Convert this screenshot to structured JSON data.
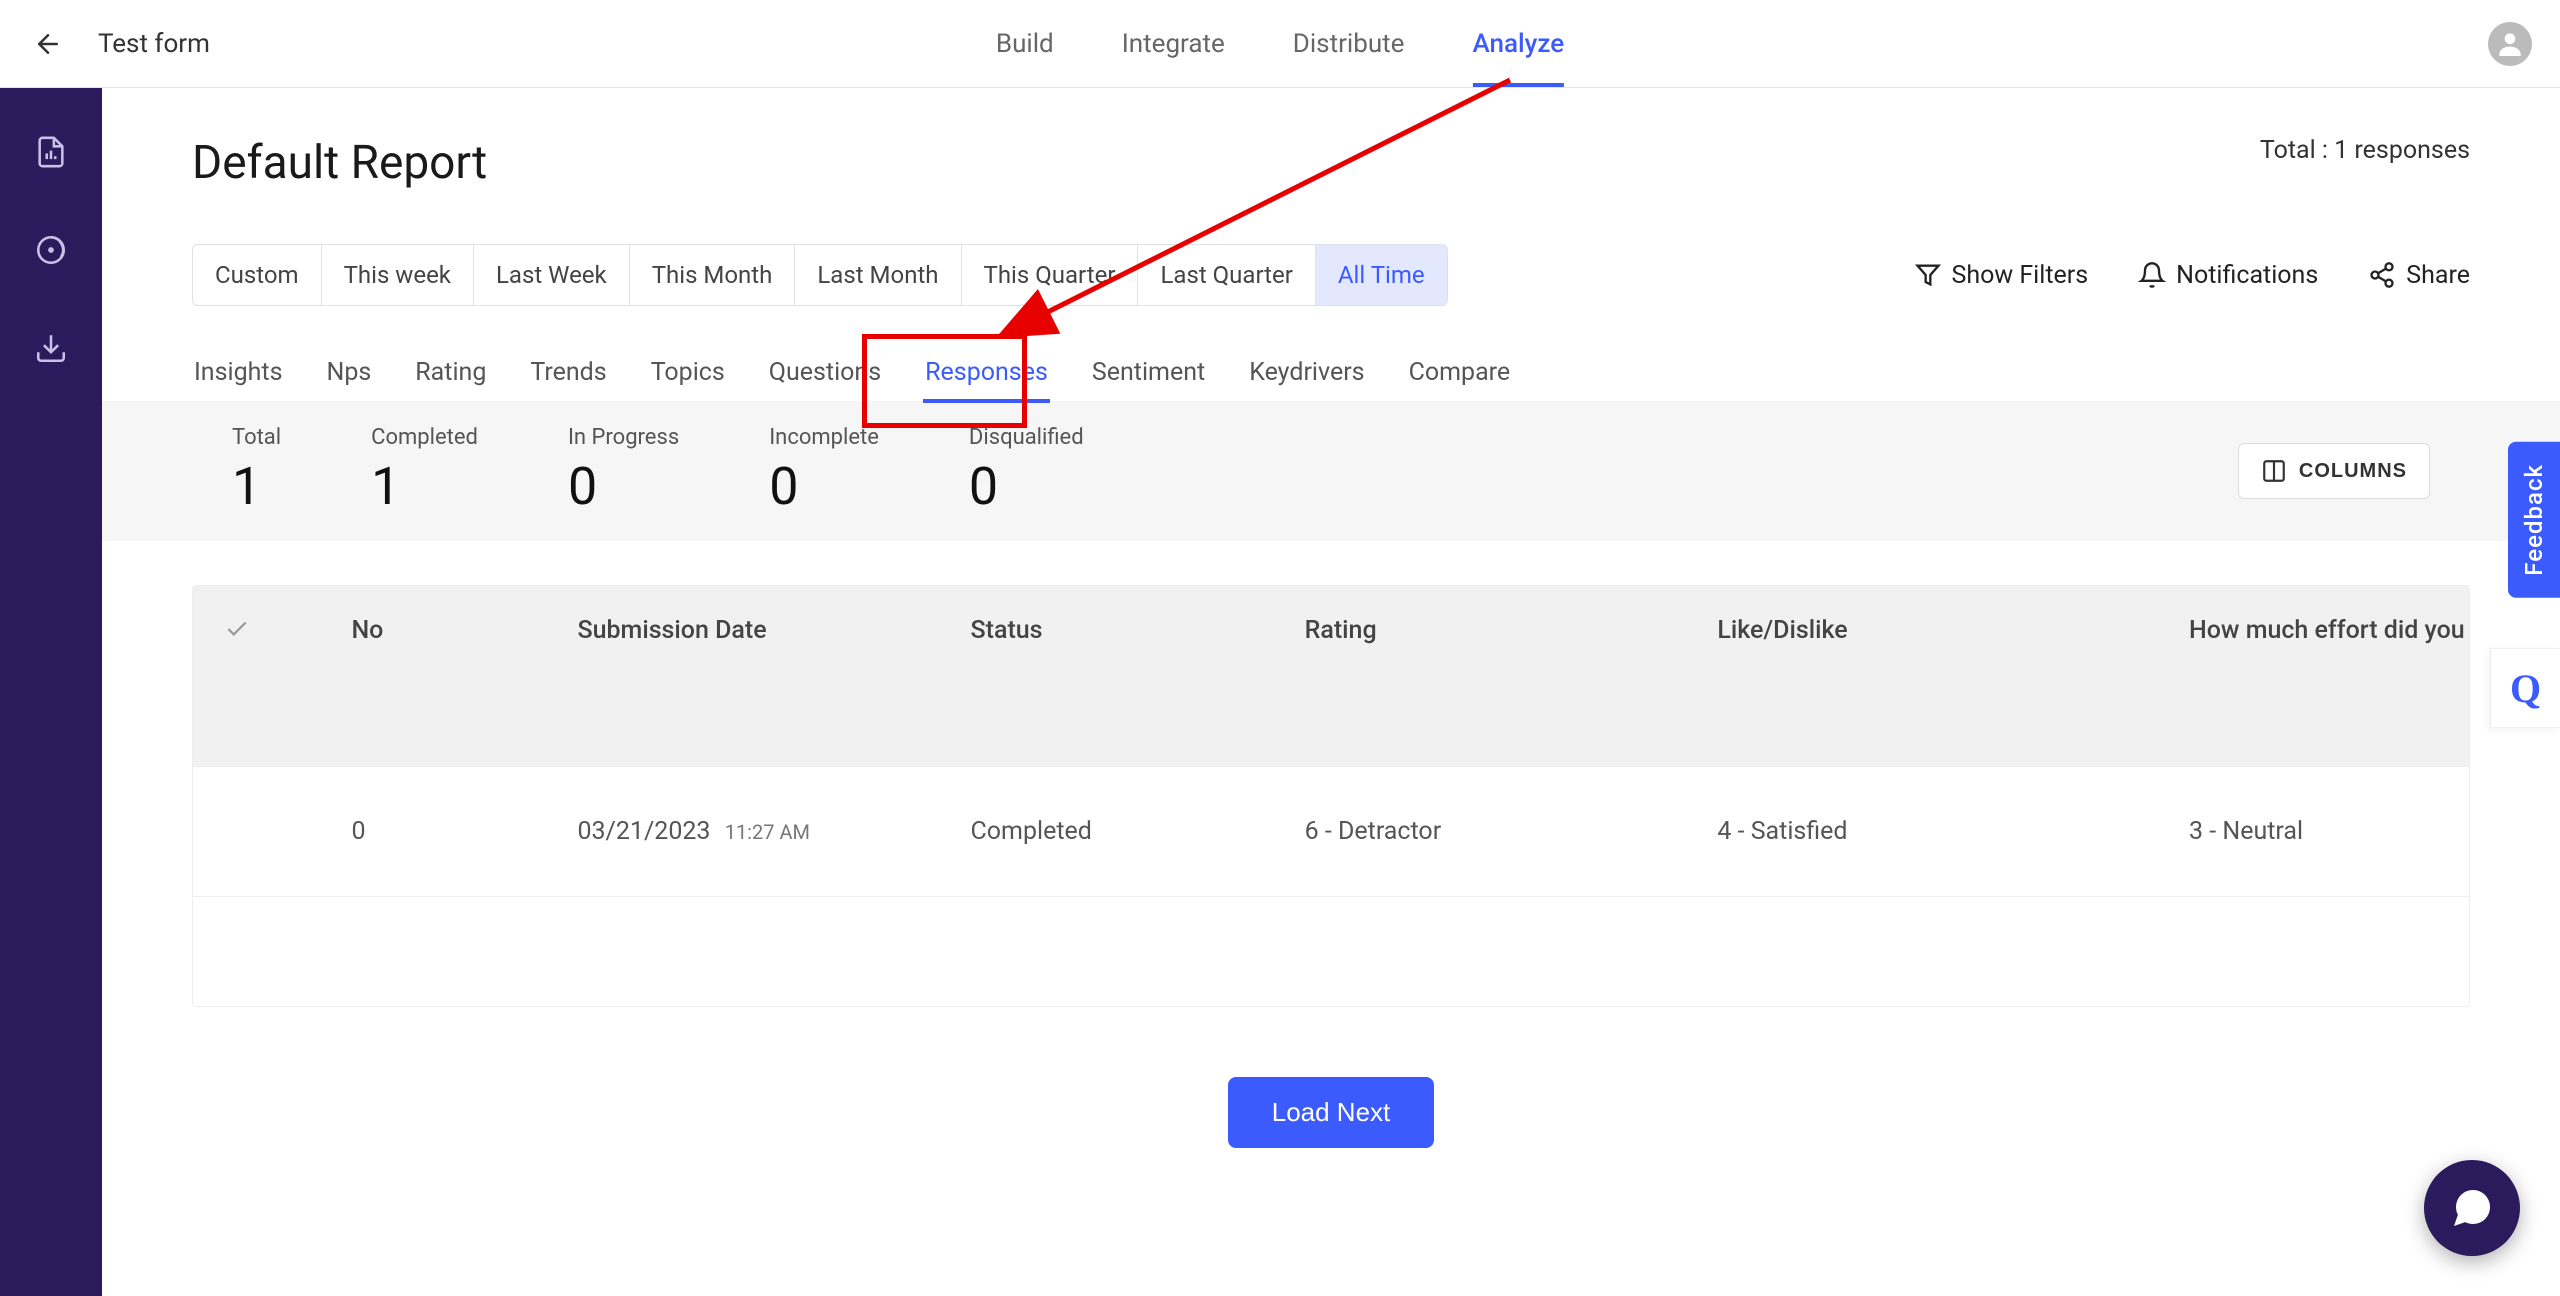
{
  "header": {
    "form_name": "Test form",
    "tabs": [
      "Build",
      "Integrate",
      "Distribute",
      "Analyze"
    ],
    "active_tab": "Analyze"
  },
  "report": {
    "title": "Default Report",
    "total_label": "Total : 1 responses"
  },
  "time_filters": [
    "Custom",
    "This week",
    "Last Week",
    "This Month",
    "Last Month",
    "This Quarter",
    "Last Quarter",
    "All Time"
  ],
  "active_time_filter": "All Time",
  "actions": {
    "filters": "Show Filters",
    "notifications": "Notifications",
    "share": "Share"
  },
  "subtabs": [
    "Insights",
    "Nps",
    "Rating",
    "Trends",
    "Topics",
    "Questions",
    "Responses",
    "Sentiment",
    "Keydrivers",
    "Compare"
  ],
  "active_subtab": "Responses",
  "stats": {
    "total": {
      "label": "Total",
      "value": "1"
    },
    "completed": {
      "label": "Completed",
      "value": "1"
    },
    "in_progress": {
      "label": "In Progress",
      "value": "0"
    },
    "incomplete": {
      "label": "Incomplete",
      "value": "0"
    },
    "disqualified": {
      "label": "Disqualified",
      "value": "0"
    }
  },
  "columns_button": "COLUMNS",
  "table": {
    "headers": {
      "no": "No",
      "submission_date": "Submission Date",
      "status": "Status",
      "rating": "Rating",
      "like_dislike": "Like/Dislike",
      "effort": "How much effort did you"
    },
    "row": {
      "no": "0",
      "date": "03/21/2023",
      "time": "11:27 AM",
      "status": "Completed",
      "rating": "6 - Detractor",
      "like_dislike": "4 - Satisfied",
      "effort": "3 - Neutral"
    }
  },
  "load_next": "Load Next",
  "feedback_label": "Feedback",
  "q_badge": "Q"
}
